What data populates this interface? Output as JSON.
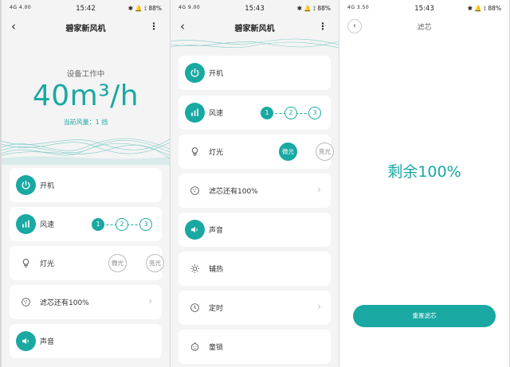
{
  "status_bar": [
    {
      "signal": "4G 4.00",
      "time": "15:42",
      "right": "✱ 🔔 ⟟ 88%"
    },
    {
      "signal": "4G 9.00",
      "time": "15:43",
      "right": "✱ 🔔 ⟟ 88%"
    },
    {
      "signal": "4G 3.50",
      "time": "15:43",
      "right": "✱ 🔔 ⟟ 88%"
    }
  ],
  "nav": {
    "back_glyph": "‹",
    "more_glyph": "⋮",
    "device_title": "碧家新风机",
    "filter_title": "滤芯"
  },
  "hero": {
    "status": "设备工作中",
    "flow": "40m³/h",
    "current_speed": "当前风量：1 挡"
  },
  "controls": {
    "power": "开机",
    "speed": "风速",
    "speed_levels": [
      "1",
      "2",
      "3"
    ],
    "speed_active": "1",
    "light": "灯光",
    "light_options": [
      "微光",
      "亮光"
    ],
    "filter": "滤芯还有100%",
    "sound": "声音",
    "heat": "辅热",
    "timer": "定时",
    "child_lock": "童锁"
  },
  "filter_page": {
    "remaining": "剩余100%",
    "reset_button": "重置滤芯"
  },
  "colors": {
    "accent": "#19a8a2",
    "card": "#ffffff",
    "background": "#f4f4f4"
  },
  "icons": {
    "power": "power-icon",
    "speed": "fan-speed-icon",
    "light": "bulb-icon",
    "filter": "filter-icon",
    "sound": "speaker-icon",
    "heat": "sun-icon",
    "timer": "clock-icon",
    "child_lock": "baby-face-icon"
  }
}
